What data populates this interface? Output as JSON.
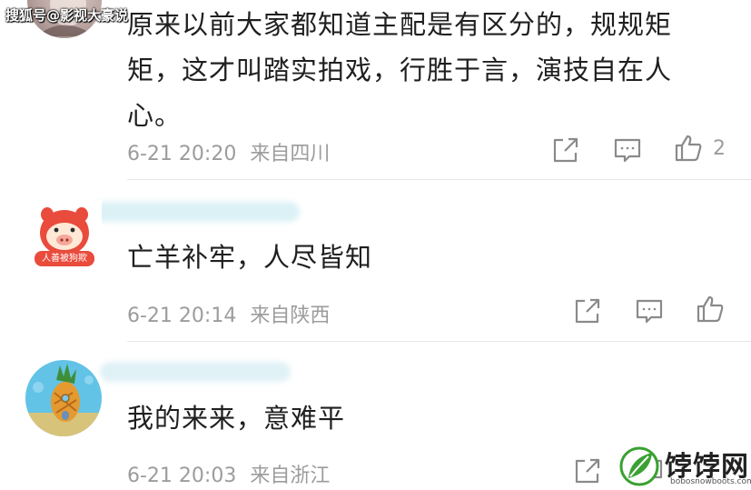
{
  "watermark_source": "搜狐号@影视大豪说",
  "comments": [
    {
      "text": "原来以前大家都知道主配是有区分的，规规矩矩，这才叫踏实拍戏，行胜于言，演技自在人心。",
      "time": "6-21 20:20",
      "location": "来自四川",
      "likes": "2",
      "avatar": "photo-avatar-icon"
    },
    {
      "text": "亡羊补牢，人尽皆知",
      "time": "6-21 20:14",
      "location": "来自陕西",
      "likes": "",
      "avatar": "pig-mascot-avatar-icon",
      "avatar_badge": "人善被狗欺"
    },
    {
      "text": "我的来来，意难平",
      "time": "6-21 20:03",
      "location": "来自浙江",
      "likes": "",
      "avatar": "pineapple-house-avatar-icon"
    }
  ],
  "brand_watermark": {
    "name": "饽饽网",
    "url": "bobosnowboots.com",
    "accent": "#3aa132"
  },
  "colors": {
    "text": "#1f1f1f",
    "meta": "#9c9c9c",
    "icon": "#8a8a8a",
    "divider": "#e6e6e6"
  }
}
